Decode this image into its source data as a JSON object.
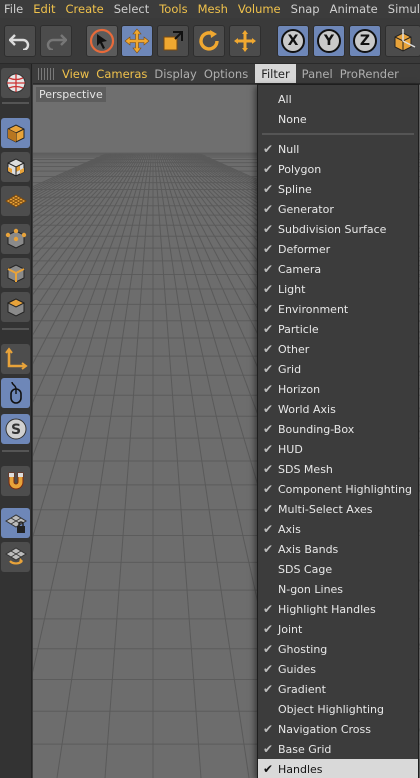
{
  "menubar": {
    "items": [
      {
        "label": "File",
        "style": "dim"
      },
      {
        "label": "Edit",
        "style": "hl"
      },
      {
        "label": "Create",
        "style": "hl"
      },
      {
        "label": "Select",
        "style": "dim"
      },
      {
        "label": "Tools",
        "style": "hl"
      },
      {
        "label": "Mesh",
        "style": "hl"
      },
      {
        "label": "Volume",
        "style": "hl"
      },
      {
        "label": "Snap",
        "style": "dim"
      },
      {
        "label": "Animate",
        "style": "dim"
      },
      {
        "label": "Simul",
        "style": "dim"
      }
    ]
  },
  "toolbar": {
    "undo_icon": "undo-icon",
    "redo_icon": "redo-icon",
    "axis_x": "X",
    "axis_y": "Y",
    "axis_z": "Z"
  },
  "viewport_menu": {
    "items": [
      {
        "label": "View",
        "style": "hl"
      },
      {
        "label": "Cameras",
        "style": "hl"
      },
      {
        "label": "Display",
        "style": "dim"
      },
      {
        "label": "Options",
        "style": "dim"
      },
      {
        "label": "Filter",
        "style": "open"
      },
      {
        "label": "Panel",
        "style": "dim"
      },
      {
        "label": "ProRender",
        "style": "dim"
      }
    ]
  },
  "viewport": {
    "label": "Perspective",
    "background": "#6d6d6d"
  },
  "filter_menu": {
    "top_items": [
      "All",
      "None"
    ],
    "items": [
      {
        "label": "Null",
        "checked": true
      },
      {
        "label": "Polygon",
        "checked": true
      },
      {
        "label": "Spline",
        "checked": true
      },
      {
        "label": "Generator",
        "checked": true
      },
      {
        "label": "Subdivision Surface",
        "checked": true
      },
      {
        "label": "Deformer",
        "checked": true
      },
      {
        "label": "Camera",
        "checked": true
      },
      {
        "label": "Light",
        "checked": true
      },
      {
        "label": "Environment",
        "checked": true
      },
      {
        "label": "Particle",
        "checked": true
      },
      {
        "label": "Other",
        "checked": true
      },
      {
        "label": "Grid",
        "checked": true
      },
      {
        "label": "Horizon",
        "checked": true
      },
      {
        "label": "World Axis",
        "checked": true
      },
      {
        "label": "Bounding-Box",
        "checked": true
      },
      {
        "label": "HUD",
        "checked": true
      },
      {
        "label": "SDS Mesh",
        "checked": true
      },
      {
        "label": "Component Highlighting",
        "checked": true
      },
      {
        "label": "Multi-Select Axes",
        "checked": true
      },
      {
        "label": "Axis",
        "checked": true
      },
      {
        "label": "Axis Bands",
        "checked": true
      },
      {
        "label": "SDS Cage",
        "checked": false
      },
      {
        "label": "N-gon Lines",
        "checked": false
      },
      {
        "label": "Highlight Handles",
        "checked": true
      },
      {
        "label": "Joint",
        "checked": true
      },
      {
        "label": "Ghosting",
        "checked": true
      },
      {
        "label": "Guides",
        "checked": true
      },
      {
        "label": "Gradient",
        "checked": true
      },
      {
        "label": "Object Highlighting",
        "checked": false
      },
      {
        "label": "Navigation Cross",
        "checked": true
      },
      {
        "label": "Base Grid",
        "checked": true
      },
      {
        "label": "Handles",
        "checked": true,
        "hot": true
      }
    ]
  },
  "colors": {
    "accent": "#f0c24c",
    "active_tool": "#6e87b8",
    "icon_orange": "#e8a33a"
  }
}
